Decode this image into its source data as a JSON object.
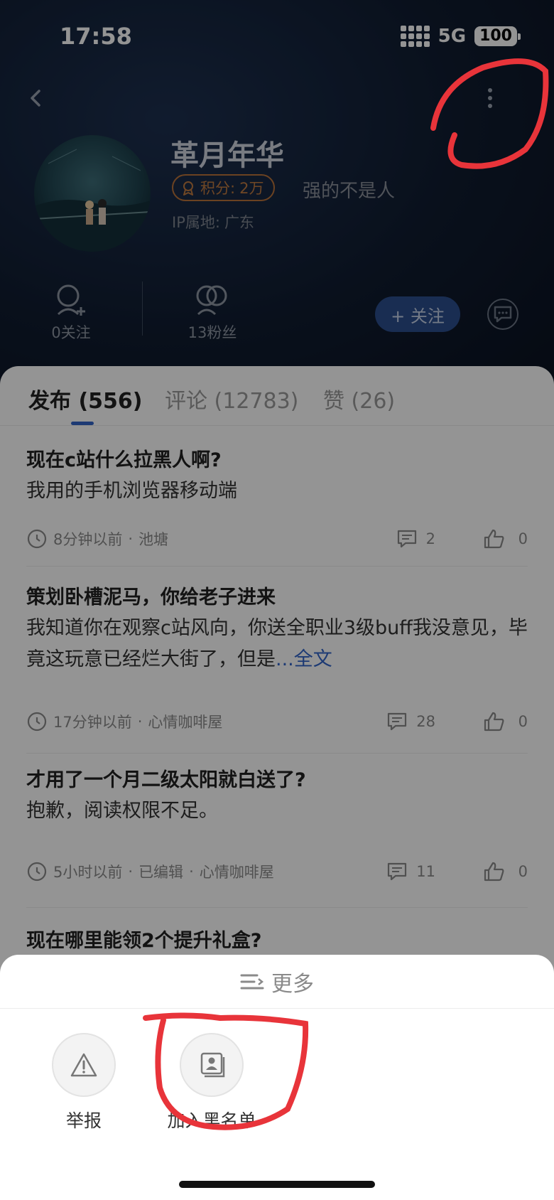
{
  "status_bar": {
    "time": "17:58",
    "network": "5G",
    "battery": "100"
  },
  "profile": {
    "nickname": "革月年华",
    "score_label": "积分:",
    "score_value": "2万",
    "signature": "强的不是人",
    "ip_label": "IP属地:",
    "ip_value": "广东",
    "following": "0关注",
    "followers": "13粉丝",
    "follow_button": "+ 关注"
  },
  "tabs": [
    {
      "label": "发布 (556)",
      "active": true
    },
    {
      "label": "评论 (12783)",
      "active": false
    },
    {
      "label": "赞 (26)",
      "active": false
    }
  ],
  "posts": [
    {
      "title": "现在c站什么拉黑人啊?",
      "body": "我用的手机浏览器移动端",
      "more": "",
      "time": "8分钟以前",
      "edited": "",
      "board": "池塘",
      "comments": "2",
      "likes": "0"
    },
    {
      "title": "策划卧槽泥马，你给老子进来",
      "body": "我知道你在观察c站风向，你送全职业3级buff我没意见，毕竟这玩意已经烂大街了，但是",
      "more": "...全文",
      "time": "17分钟以前",
      "edited": "",
      "board": "心情咖啡屋",
      "comments": "28",
      "likes": "0"
    },
    {
      "title": "才用了一个月二级太阳就白送了?",
      "body": "抱歉，阅读权限不足。",
      "more": "",
      "time": "5小时以前",
      "edited": "已编辑",
      "board": "心情咖啡屋",
      "comments": "11",
      "likes": "0"
    },
    {
      "title": "现在哪里能领2个提升礼盒?",
      "body": "",
      "more": "",
      "time": "",
      "edited": "",
      "board": "",
      "comments": "",
      "likes": ""
    }
  ],
  "sheet": {
    "title": "更多",
    "actions": [
      {
        "label": "举报",
        "icon": "warning-icon"
      },
      {
        "label": "加入黑名单",
        "icon": "blacklist-icon"
      }
    ]
  },
  "colors": {
    "header_bg": "#101c30",
    "accent": "#3264c8",
    "score_badge": "#c07a40",
    "annotation": "#e8343a"
  }
}
